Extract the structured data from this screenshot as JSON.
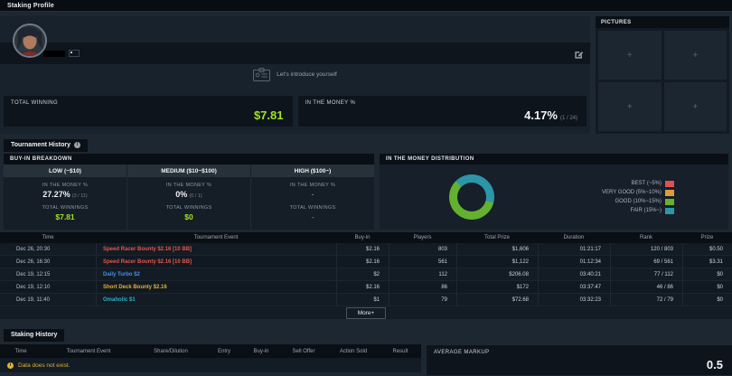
{
  "app": {
    "title": "Staking Profile"
  },
  "profile": {
    "intro_prompt": "Let's introduce yourself",
    "total_winning": {
      "label": "TOTAL WINNING",
      "value": "$7.81"
    },
    "in_the_money": {
      "label": "IN THE MONEY %",
      "value": "4.17%",
      "fraction": "(1 / 24)"
    },
    "pictures": {
      "title": "PICTURES",
      "slot_count": 4,
      "plus_icon": "+"
    }
  },
  "tournament_history": {
    "section_title": "Tournament History",
    "buyin_breakdown": {
      "title": "BUY-IN BREAKDOWN",
      "itm_label": "IN THE MONEY %",
      "winnings_label": "TOTAL WINNINGS",
      "tiers": [
        {
          "name": "LOW (~$10)",
          "itm_value": "27.27%",
          "itm_fraction": "(3 / 11)",
          "winnings": "$7.81"
        },
        {
          "name": "MEDIUM ($10~$100)",
          "itm_value": "0%",
          "itm_fraction": "(0 / 1)",
          "winnings": "$0"
        },
        {
          "name": "HIGH ($100~)",
          "itm_value": "-",
          "itm_fraction": "",
          "winnings": "-"
        }
      ]
    },
    "itm_distribution": {
      "title": "IN THE MONEY DISTRIBUTION"
    },
    "table": {
      "headers": [
        "Time",
        "Tournament Event",
        "Buy-in",
        "Players",
        "Total Prize",
        "Duration",
        "Rank",
        "Prize"
      ],
      "rows": [
        {
          "time": "Dec 26, 20:30",
          "event": "Speed Racer Bounty $2.16 [10 BB]",
          "event_color": "#e2574b",
          "buyin": "$2.16",
          "players": "803",
          "total_prize": "$1,606",
          "duration": "01:21:17",
          "rank": "120 / 803",
          "prize": "$0.50"
        },
        {
          "time": "Dec 26, 16:30",
          "event": "Speed Racer Bounty $2.16 [10 BB]",
          "event_color": "#e2574b",
          "buyin": "$2.16",
          "players": "561",
          "total_prize": "$1,122",
          "duration": "01:12:34",
          "rank": "69 / 561",
          "prize": "$3.31"
        },
        {
          "time": "Dec 19, 12:15",
          "event": "Daily Turbo $2",
          "event_color": "#4a8fe2",
          "buyin": "$2",
          "players": "112",
          "total_prize": "$206.08",
          "duration": "03:40:21",
          "rank": "77 / 112",
          "prize": "$0"
        },
        {
          "time": "Dec 19, 12:10",
          "event": "Short Deck Bounty $2.16",
          "event_color": "#e2b231",
          "buyin": "$2.16",
          "players": "86",
          "total_prize": "$172",
          "duration": "03:37:47",
          "rank": "46 / 86",
          "prize": "$0"
        },
        {
          "time": "Dec 19, 11:40",
          "event": "Omaholic $1",
          "event_color": "#2eb3c4",
          "buyin": "$1",
          "players": "79",
          "total_prize": "$72.68",
          "duration": "03:32:23",
          "rank": "72 / 79",
          "prize": "$0"
        }
      ],
      "more_label": "More+"
    }
  },
  "staking_history": {
    "section_title": "Staking History",
    "headers": [
      "Time",
      "Tournament Event",
      "Share/Dilution",
      "Entry",
      "Buy-in",
      "Sell Offer",
      "Action Sold",
      "Result"
    ],
    "empty_message": "Data does not exist.",
    "average_markup": {
      "label": "AVERAGE MARKUP",
      "value": "0.5"
    }
  },
  "chart_data": {
    "type": "pie",
    "title": "IN THE MONEY DISTRIBUTION",
    "hole": true,
    "start_angle_deg": 315,
    "legend_position": "right",
    "segments": [
      {
        "label": "FAIR (15%~)",
        "value": 41.7,
        "color": "#2d95a8"
      },
      {
        "label": "GOOD (10%~15%)",
        "value": 58.3,
        "color": "#63b22f"
      },
      {
        "label": "BEST (~5%)",
        "value": 0,
        "color": "#d95450"
      },
      {
        "label": "VERY GOOD (5%~10%)",
        "value": 0,
        "color": "#dd9c3a"
      }
    ],
    "legend": [
      {
        "label": "BEST (~5%)",
        "color": "#d95450"
      },
      {
        "label": "VERY GOOD (5%~10%)",
        "color": "#dd9c3a"
      },
      {
        "label": "GOOD (10%~15%)",
        "color": "#63b22f"
      },
      {
        "label": "FAIR (15%~)",
        "color": "#2d95a8"
      }
    ]
  }
}
